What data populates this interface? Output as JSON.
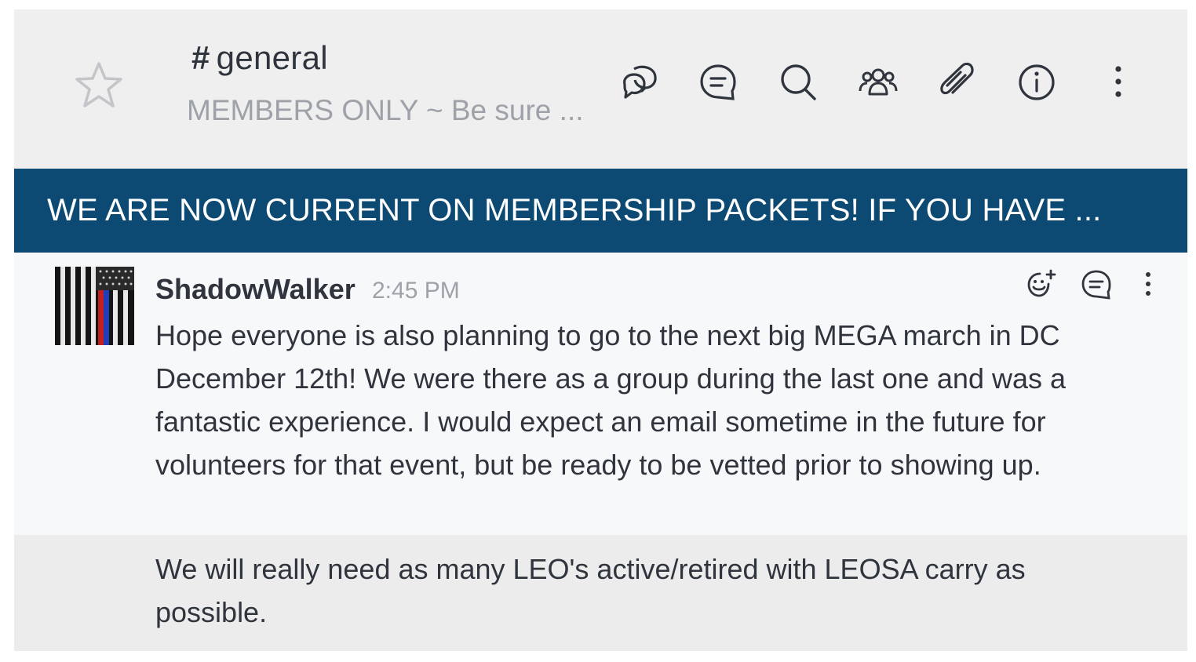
{
  "header": {
    "title_hash": "#",
    "title": "general",
    "topic": "MEMBERS ONLY ~ Be sure ...",
    "icons": [
      "star-icon",
      "discussion-icon",
      "threads-icon",
      "search-icon",
      "members-icon",
      "files-icon",
      "info-icon",
      "kebab-menu-icon"
    ]
  },
  "announcement": {
    "text": "WE ARE NOW CURRENT ON MEMBERSHIP PACKETS! IF YOU HAVE ..."
  },
  "messages": [
    {
      "username": "ShadowWalker",
      "time": "2:45 PM",
      "text": "Hope everyone is also planning to go to the next big MEGA march in DC December 12th! We were there as a group during the last one and was a fantastic experience. I would expect an email sometime in the future for volunteers for that event, but be ready to be vetted prior to showing up.",
      "actions": [
        "add-reaction-icon",
        "reply-thread-icon",
        "message-menu-icon"
      ]
    },
    {
      "text": "We will really need as many LEO's active/retired with LEOSA carry as possible."
    }
  ],
  "colors": {
    "announcement_bg": "#0c4a73",
    "header_bg": "#efefef",
    "text": "#2f343d",
    "muted": "#9ea2a8"
  }
}
